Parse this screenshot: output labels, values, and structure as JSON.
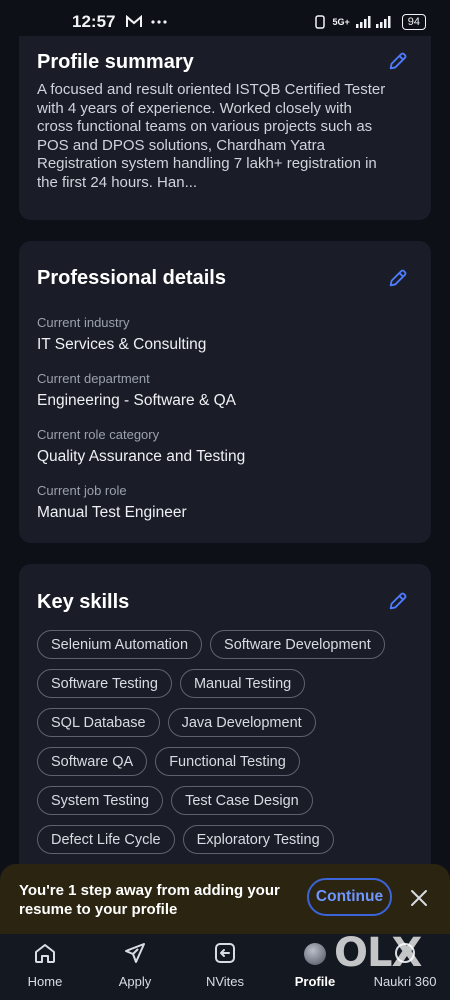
{
  "status_bar": {
    "time": "12:57",
    "network": "5G+",
    "battery": "94",
    "icons": [
      "mail-icon",
      "more-dots-icon",
      "vibrate-icon",
      "signal-icon"
    ]
  },
  "profile_summary": {
    "title": "Profile summary",
    "text": "A focused and result oriented ISTQB Certified Tester with 4 years of experience. Worked closely with cross functional teams on various projects such as POS and DPOS solutions, Chardham Yatra Registration system handling 7 lakh+ registration in the first 24 hours. Han..."
  },
  "professional_details": {
    "title": "Professional details",
    "items": [
      {
        "label": "Current industry",
        "value": "IT Services & Consulting"
      },
      {
        "label": "Current department",
        "value": "Engineering - Software & QA"
      },
      {
        "label": "Current role category",
        "value": "Quality Assurance and Testing"
      },
      {
        "label": "Current job role",
        "value": "Manual Test Engineer"
      }
    ]
  },
  "key_skills": {
    "title": "Key skills",
    "skills": [
      "Selenium Automation",
      "Software Development",
      "Software Testing",
      "Manual Testing",
      "SQL Database",
      "Java Development",
      "Software QA",
      "Functional Testing",
      "System Testing",
      "Test Case Design",
      "Defect Life Cycle",
      "Exploratory Testing"
    ]
  },
  "banner": {
    "text": "You're 1 step away from adding your resume to your profile",
    "button": "Continue"
  },
  "bottom_nav": {
    "items": [
      {
        "label": "Home",
        "icon": "home-icon"
      },
      {
        "label": "Apply",
        "icon": "send-icon"
      },
      {
        "label": "NVites",
        "icon": "nvites-icon"
      },
      {
        "label": "Profile",
        "icon": "avatar-icon",
        "active": true
      },
      {
        "label": "Naukri 360",
        "icon": "naukri-360-icon"
      }
    ]
  },
  "watermark": "OLX",
  "colors": {
    "background": "#0d1016",
    "card": "#1a1d27",
    "accent": "#3b64d9",
    "banner": "#2a2410"
  }
}
